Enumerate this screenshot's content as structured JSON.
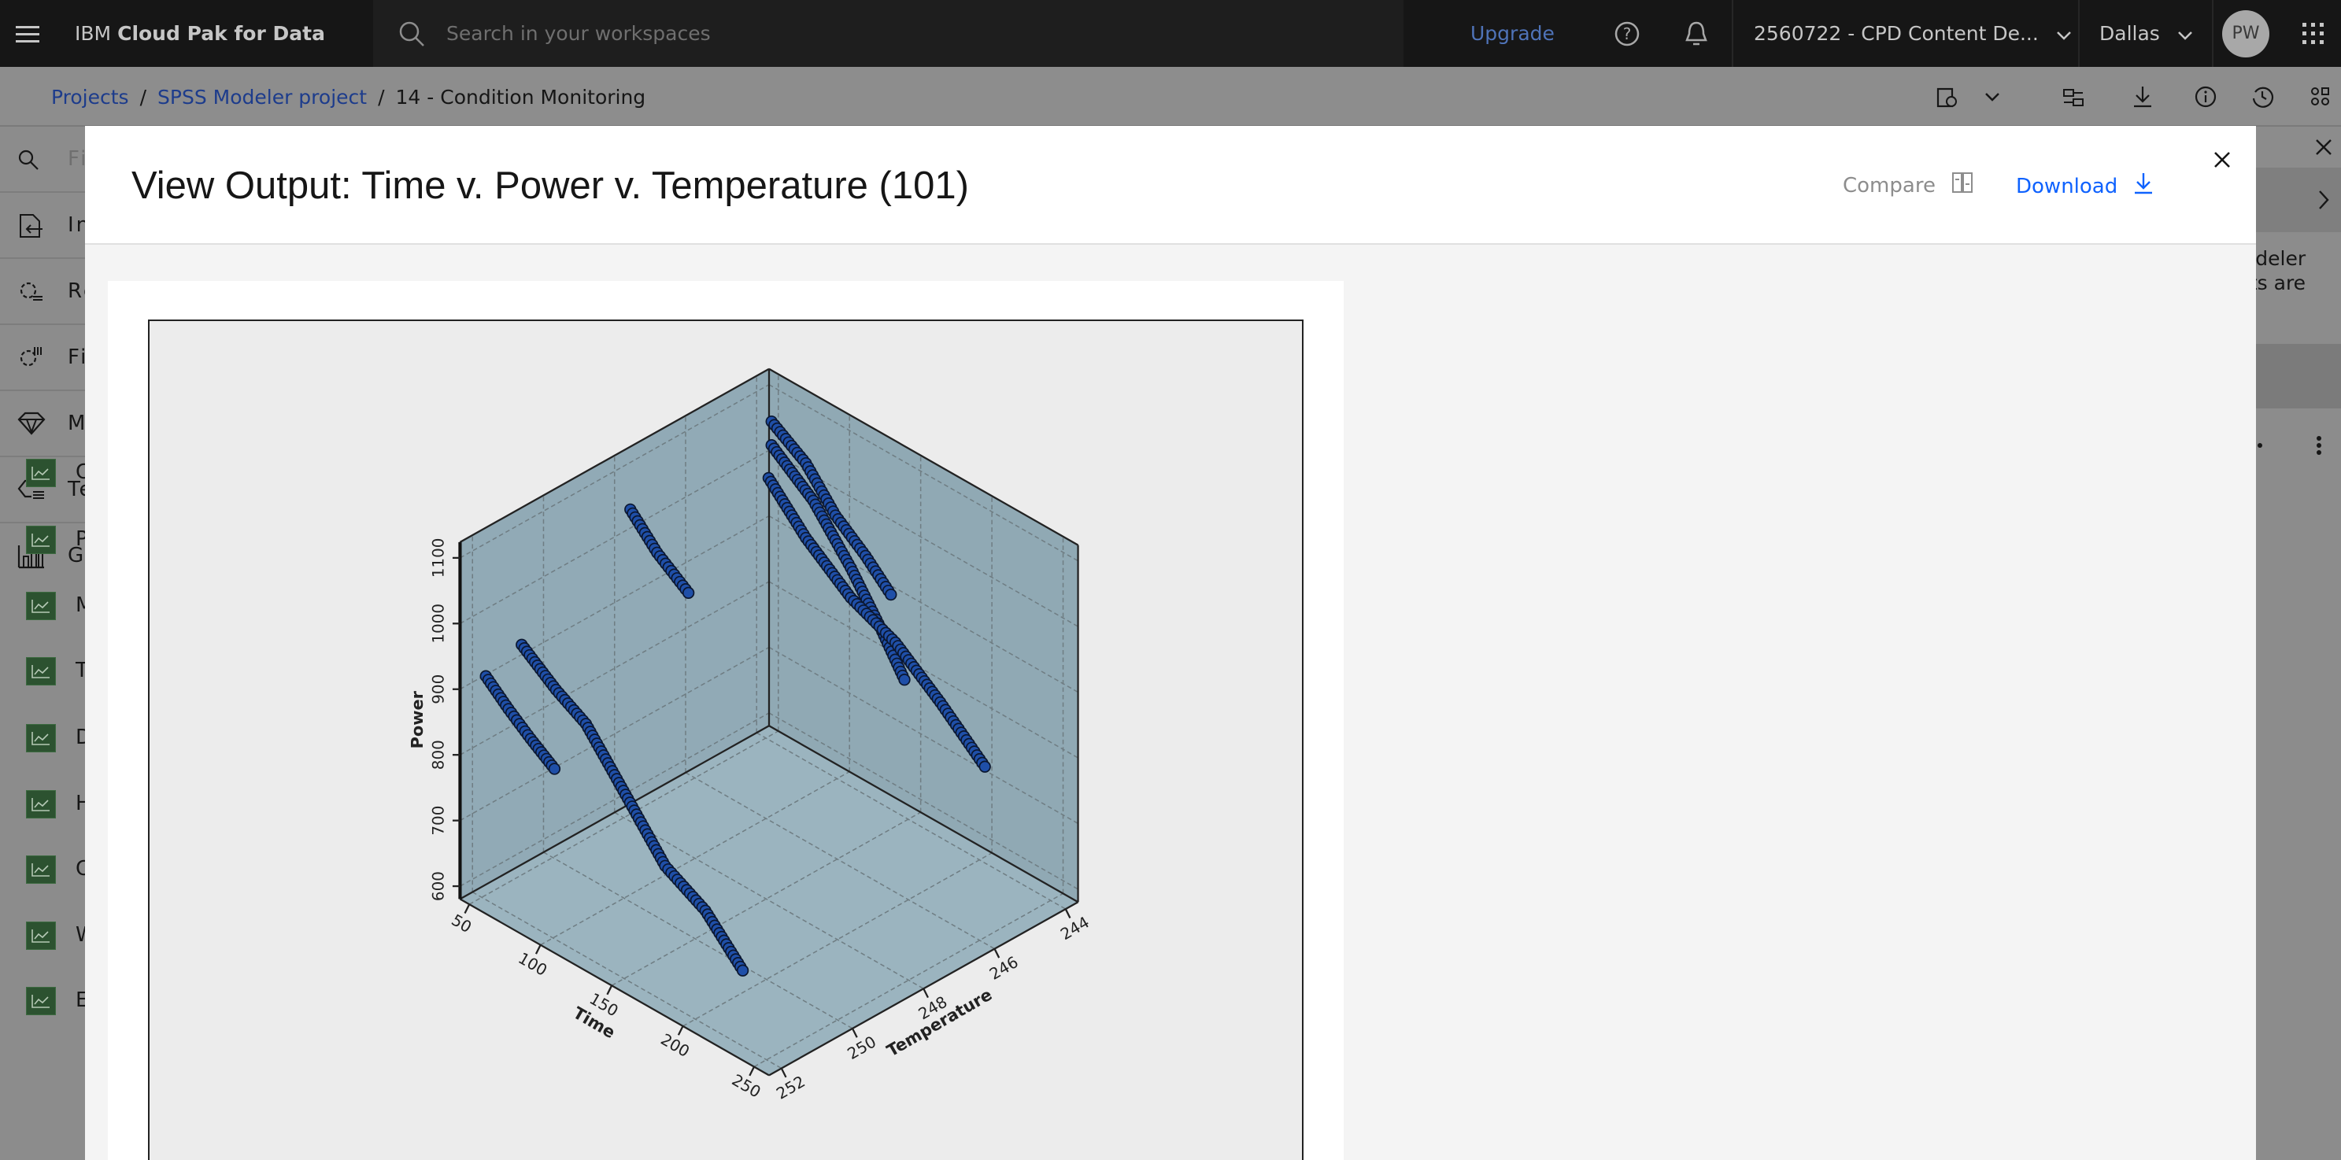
{
  "topbar": {
    "brand_prefix": "IBM",
    "brand_name": "Cloud Pak for Data",
    "search_placeholder": "Search in your workspaces",
    "upgrade": "Upgrade",
    "account": "2560722 - CPD Content De...",
    "region": "Dallas",
    "avatar_initials": "PW"
  },
  "breadcrumb": {
    "items": [
      "Projects",
      "SPSS Modeler project"
    ],
    "current": "14 - Condition Monitoring",
    "separator": "/"
  },
  "sidebar": {
    "search_placeholder": "Fi",
    "items": [
      "In",
      "Re",
      "Fi",
      "M",
      "Te",
      "Gr"
    ],
    "sub_items": [
      "C",
      "P",
      "M",
      "T",
      "D",
      "H",
      "C",
      "W",
      "E"
    ]
  },
  "right_panel": {
    "text_lines": [
      "odeler",
      "uts are"
    ]
  },
  "modal": {
    "title": "View Output: Time v. Power v. Temperature (101)",
    "compare": "Compare",
    "download": "Download"
  },
  "colors": {
    "accent": "#0f62fe",
    "wall": "#91abb7",
    "floor": "#9bb5c0",
    "point": "#1f4fa8",
    "sidebar_icon": "#2c5230"
  },
  "chart_data": {
    "type": "scatter3d",
    "axes": {
      "x": {
        "label": "Time",
        "range": [
          43.5,
          260.5
        ],
        "ticks": [
          50,
          100,
          150,
          200,
          250
        ]
      },
      "y": {
        "label": "Temperature",
        "range": [
          252.35,
          243.65
        ],
        "ticks": [
          252,
          250,
          248,
          246,
          244
        ]
      },
      "z": {
        "label": "Power",
        "range": [
          580.4,
          1124
        ],
        "ticks": [
          600,
          700,
          800,
          900,
          1000,
          1100
        ]
      }
    },
    "grid": true,
    "series": [
      {
        "points": [
          [
            50.4,
            251.9,
            914.7
          ],
          [
            66.3,
            251.9,
            884.3
          ],
          [
            81.9,
            251.9,
            858.2
          ],
          [
            98.6,
            251.9,
            833.2
          ]
        ]
      },
      {
        "points": [
          [
            75.6,
            251.9,
            993.7
          ],
          [
            99.7,
            251.9,
            955
          ],
          [
            120.7,
            251.9,
            929
          ],
          [
            150.1,
            251.9,
            851.5
          ],
          [
            176.3,
            251.9,
            781.5
          ],
          [
            204.6,
            251.9,
            748.3
          ],
          [
            230.8,
            251.9,
            689.6
          ]
        ]
      },
      {
        "points": [
          [
            54.6,
            248.0,
            1055.5
          ],
          [
            73.4,
            248.0,
            1013
          ],
          [
            95.4,
            248.0,
            979
          ]
        ]
      },
      {
        "points": [
          [
            56.5,
            244.1,
            1073.5
          ],
          [
            80.6,
            244.1,
            1039.8
          ],
          [
            101.4,
            244.1,
            986
          ],
          [
            122.5,
            244.1,
            950.6
          ],
          [
            140.3,
            244.1,
            913.6
          ]
        ]
      },
      {
        "points": [
          [
            56.5,
            244.1,
            1037.5
          ],
          [
            85.8,
            244.1,
            989.2
          ],
          [
            112.1,
            244.1,
            919.6
          ],
          [
            132.9,
            244.1,
            854.4
          ],
          [
            149.8,
            244.1,
            795.7
          ]
        ]
      },
      {
        "points": [
          [
            54.4,
            244.1,
            984.9
          ],
          [
            80.6,
            244.1,
            926.1
          ],
          [
            112.1,
            244.1,
            874
          ],
          [
            143.5,
            244.1,
            844.6
          ],
          [
            175,
            244.1,
            792.4
          ],
          [
            206.3,
            244.1,
            733.2
          ]
        ]
      }
    ]
  }
}
